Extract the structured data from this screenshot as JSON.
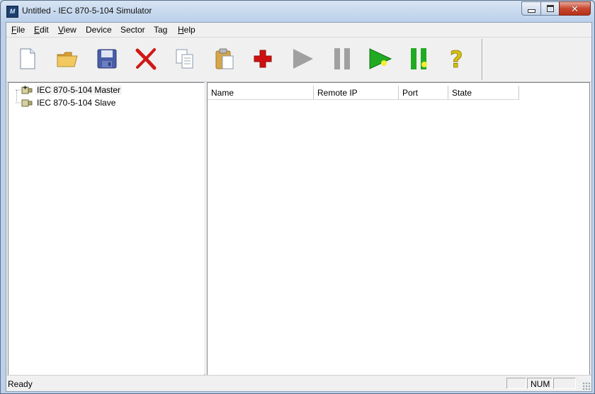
{
  "window": {
    "title": "Untitled - IEC 870-5-104 Simulator",
    "app_icon_glyph": "M"
  },
  "menu": [
    {
      "label": "File",
      "accel": "F",
      "rest": "ile"
    },
    {
      "label": "Edit",
      "accel": "E",
      "rest": "dit"
    },
    {
      "label": "View",
      "accel": "V",
      "rest": "iew"
    },
    {
      "label": "Device",
      "accel": "",
      "rest": "Device"
    },
    {
      "label": "Sector",
      "accel": "",
      "rest": "Sector"
    },
    {
      "label": "Tag",
      "accel": "",
      "rest": "Tag"
    },
    {
      "label": "Help",
      "accel": "H",
      "rest": "elp"
    }
  ],
  "toolbar": {
    "buttons": [
      "new-file-icon",
      "open-folder-icon",
      "save-disk-icon",
      "delete-x-icon",
      "copy-icon",
      "paste-icon",
      "add-plus-icon",
      "run-icon",
      "pause-icon",
      "run-all-icon",
      "pause-all-icon",
      "help-question-icon"
    ],
    "colors": {
      "plus": "#d01010",
      "delete": "#d01818",
      "play_green": "#22aa22",
      "disabled_gray": "#a0a0a0",
      "help": "#d4c010",
      "folder": "#e6b64a",
      "save": "#4a5ea8"
    }
  },
  "tree": {
    "items": [
      {
        "label": "IEC 870-5-104 Master",
        "selected": true
      },
      {
        "label": "IEC 870-5-104 Slave",
        "selected": false
      }
    ]
  },
  "list": {
    "columns": [
      "Name",
      "Remote IP",
      "Port",
      "State"
    ],
    "rows": []
  },
  "status": {
    "text": "Ready",
    "indicators": [
      "",
      "NUM",
      ""
    ]
  }
}
